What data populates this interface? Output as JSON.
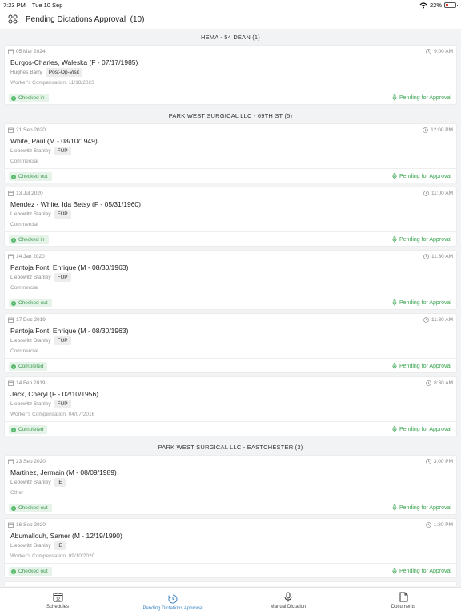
{
  "status_bar": {
    "time": "7:23 PM",
    "date": "Tue 10 Sep",
    "battery": "22%"
  },
  "header": {
    "title": "Pending Dictations Approval",
    "count": "(10)",
    "menu_icon": "grid-menu-icon"
  },
  "groups": [
    {
      "name": "HEMA - 54 DEAN (1)",
      "items": [
        {
          "date": "05 Mar 2024",
          "time": "9:00 AM",
          "patient": "Burgos-Charles, Waleska (F - 07/17/1985)",
          "provider": "Hughes Barry",
          "visit": "Post-Op-Visit",
          "insurance": "Worker's Compensation, 11/18/2023",
          "status": "Checked in",
          "approval": "Pending for Approval"
        }
      ]
    },
    {
      "name": "PARK WEST SURGICAL LLC - 69TH ST (5)",
      "items": [
        {
          "date": "21 Sep 2020",
          "time": "12:00 PM",
          "patient": "White, Paul (M - 08/10/1949)",
          "provider": "Liebowitz Stanley",
          "visit": "FUP",
          "insurance": "Commercial",
          "status": "Checked out",
          "approval": "Pending for Approval"
        },
        {
          "date": "13 Jul 2020",
          "time": "11:00 AM",
          "patient": "Mendez - White, Ida Betsy (F - 05/31/1960)",
          "provider": "Liebowitz Stanley",
          "visit": "FUP",
          "insurance": "Commercial",
          "status": "Checked in",
          "approval": "Pending for Approval"
        },
        {
          "date": "14 Jan 2020",
          "time": "11:30 AM",
          "patient": "Pantoja Font, Enrique (M - 08/30/1963)",
          "provider": "Liebowitz Stanley",
          "visit": "FUP",
          "insurance": "Commercial",
          "status": "Checked out",
          "approval": "Pending for Approval"
        },
        {
          "date": "17 Dec 2019",
          "time": "11:30 AM",
          "patient": "Pantoja Font, Enrique (M - 08/30/1963)",
          "provider": "Liebowitz Stanley",
          "visit": "FUP",
          "insurance": "Commercial",
          "status": "Completed",
          "approval": "Pending for Approval"
        },
        {
          "date": "14 Feb 2019",
          "time": "8:30 AM",
          "patient": "Jack, Cheryl (F - 02/10/1956)",
          "provider": "Liebowitz Stanley",
          "visit": "FUP",
          "insurance": "Worker's Compensation, 04/07/2016",
          "status": "Completed",
          "approval": "Pending for Approval"
        }
      ]
    },
    {
      "name": "PARK WEST SURGICAL LLC - EASTCHESTER (3)",
      "items": [
        {
          "date": "23 Sep 2020",
          "time": "3:00 PM",
          "patient": "Martinez, Jermain (M - 08/09/1989)",
          "provider": "Liebowitz Stanley",
          "visit": "IE",
          "insurance": "Other",
          "status": "Checked out",
          "approval": "Pending for Approval"
        },
        {
          "date": "16 Sep 2020",
          "time": "1:30 PM",
          "patient": "Abumallouh, Samer (M - 12/19/1990)",
          "provider": "Liebowitz Stanley",
          "visit": "IE",
          "insurance": "Worker's Compensation, 09/10/2020",
          "status": "Checked out",
          "approval": "Pending for Approval"
        }
      ]
    }
  ],
  "tabs": [
    {
      "label": "Schedules",
      "icon": "calendar-icon",
      "calendar_day": "12",
      "active": false
    },
    {
      "label": "Pending Dictations Approval",
      "icon": "clock-history-icon",
      "active": true
    },
    {
      "label": "Manual Dictation",
      "icon": "microphone-icon",
      "active": false
    },
    {
      "label": "Documents",
      "icon": "document-icon",
      "active": false
    }
  ],
  "colors": {
    "accent_blue": "#3b86c4",
    "status_green": "#3aa450",
    "badge_bg": "#e5f3e8",
    "background": "#f2f3f5"
  }
}
